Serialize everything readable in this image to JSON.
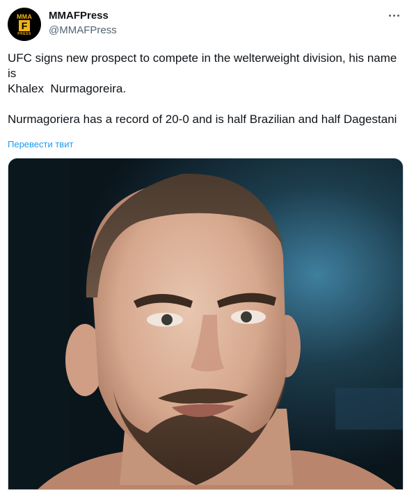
{
  "author": {
    "display_name": "MMAFPress",
    "handle": "@MMAFPress",
    "avatar": {
      "top_text": "MMA",
      "mid_text": "F",
      "bottom_text": "PRESS",
      "accent_color": "#f2b417"
    }
  },
  "tweet": {
    "text": "UFC signs new prospect to compete in the welterweight division, his name is\nKhalex  Nurmagoreira.\n\nNurmagoriera has a record of 20-0 and is half Brazilian and half Dagestani",
    "translate_label": "Перевести твит"
  },
  "media": {
    "type": "photo",
    "subject": "close-up portrait of a bearded fighter with a buzz cut"
  },
  "icons": {
    "more": "more-horizontal-icon"
  },
  "colors": {
    "link": "#1d9bf0",
    "secondary_text": "#536471",
    "primary_text": "#0f1419"
  }
}
